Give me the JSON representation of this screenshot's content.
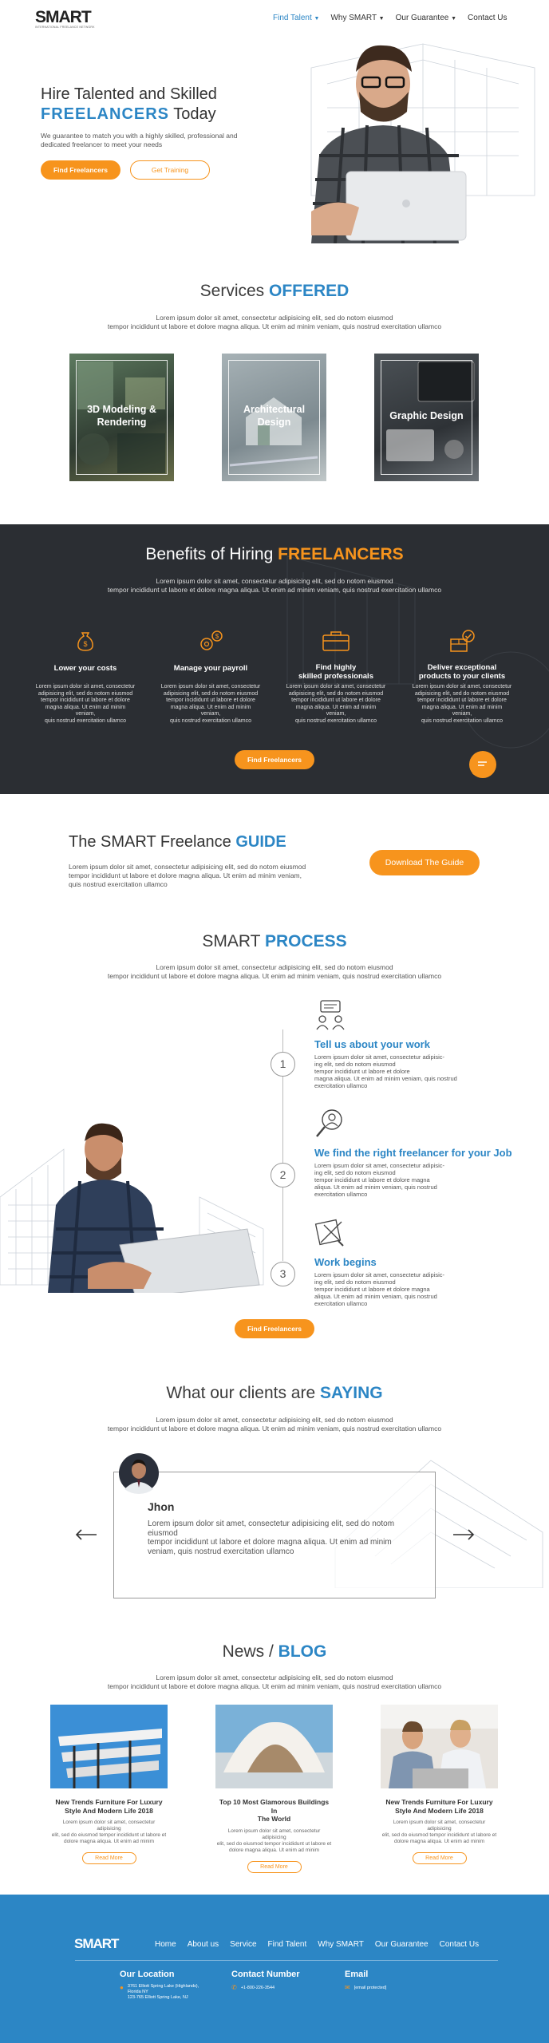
{
  "nav": {
    "logo": "SMART",
    "logo_tag": "INTERNATIONAL FREELANCE NETWORK",
    "items": [
      "Find Talent",
      "Why SMART",
      "Our Guarantee",
      "Contact Us"
    ]
  },
  "hero": {
    "line1": "Hire Talented and Skilled",
    "highlight": "FREELANCERS",
    "tail": "Today",
    "text": "We guarantee to match you with a highly skilled, professional and dedicated freelancer to meet your needs",
    "btn_primary": "Find Freelancers",
    "btn_secondary": "Get Training"
  },
  "services": {
    "title": "Services",
    "title_highlight": "OFFERED",
    "text1": "Lorem ipsum dolor sit amet, consectetur adipisicing elit, sed do notom eiusmod",
    "text2": "tempor incididunt ut labore et dolore magna aliqua. Ut enim ad minim veniam, quis nostrud exercitation ullamco",
    "cards": [
      {
        "line1": "3D Modeling &",
        "line2": "Rendering"
      },
      {
        "line1": "Architectural",
        "line2": "Design"
      },
      {
        "line1": "Graphic Design",
        "line2": ""
      }
    ]
  },
  "benefits": {
    "title": "Benefits of Hiring",
    "title_highlight": "FREELANCERS",
    "text1": "Lorem ipsum dolor sit amet, consectetur adipisicing elit, sed do notom eiusmod",
    "text2": "tempor incididunt ut labore et dolore magna aliqua. Ut enim ad minim veniam, quis nostrud exercitation ullamco",
    "items": [
      {
        "title1": "Lower your costs",
        "title2": "",
        "icon": "money-bag-icon"
      },
      {
        "title1": "Manage your payroll",
        "title2": "",
        "icon": "payroll-gear-icon"
      },
      {
        "title1": "Find highly",
        "title2": "skilled professionals",
        "icon": "briefcase-icon"
      },
      {
        "title1": "Deliver exceptional",
        "title2": "products to your clients",
        "icon": "box-check-icon"
      }
    ],
    "item_text": [
      "Lorem ipsum dolor sit amet, consectetur",
      "adipisicing elit, sed do notom eiusmod",
      "tempor incididunt ut labore et dolore",
      "magna aliqua. Ut enim ad minim veniam,",
      "quis nostrud exercitation ullamco"
    ],
    "button": "Find Freelancers"
  },
  "guide": {
    "title": "The SMART Freelance",
    "title_highlight": "GUIDE",
    "text": [
      "Lorem ipsum dolor sit amet, consectetur adipisicing elit, sed do notom eiusmod",
      "tempor incididunt ut labore et dolore magna aliqua. Ut enim ad minim veniam,",
      "quis nostrud exercitation ullamco"
    ],
    "button": "Download The Guide"
  },
  "process": {
    "title": "SMART",
    "title_highlight": "PROCESS",
    "text1": "Lorem ipsum dolor sit amet, consectetur adipisicing elit, sed do notom eiusmod",
    "text2": "tempor incididunt ut labore et dolore magna aliqua. Ut enim ad minim veniam, quis nostrud exercitation ullamco",
    "steps": [
      {
        "num": "1",
        "title": "Tell us about your work",
        "text": [
          "Lorem ipsum dolor sit amet, consectetur adipisic-",
          "ing elit, sed do notom eiusmod",
          "tempor incididunt ut labore et dolore",
          "magna aliqua. Ut enim ad minim veniam, quis nostrud",
          "exercitation ullamco"
        ]
      },
      {
        "num": "2",
        "title": "We find the right freelancer for your Job",
        "text": [
          "Lorem ipsum dolor sit amet, consectetur adipisic-",
          "ing elit, sed do notom eiusmod",
          "tempor incididunt ut labore et dolore magna",
          "aliqua. Ut enim ad minim veniam, quis nostrud",
          "exercitation ullamco"
        ]
      },
      {
        "num": "3",
        "title": "Work begins",
        "text": [
          "Lorem ipsum dolor sit amet, consectetur adipisic-",
          "ing elit, sed do notom eiusmod",
          "tempor incididunt ut labore et dolore magna",
          "aliqua. Ut enim ad minim veniam, quis nostrud",
          "exercitation ullamco"
        ]
      }
    ],
    "button": "Find Freelancers"
  },
  "testimonials": {
    "title": "What our clients are",
    "title_highlight": "SAYING",
    "text1": "Lorem ipsum dolor sit amet, consectetur adipisicing elit, sed do notom eiusmod",
    "text2": "tempor incididunt ut labore et dolore magna aliqua. Ut enim ad minim veniam, quis nostrud exercitation ullamco",
    "name": "Jhon",
    "quote": [
      "Lorem ipsum dolor sit amet, consectetur adipisicing elit, sed do notom",
      "eiusmod",
      "tempor incididunt ut labore et dolore magna aliqua. Ut enim ad minim",
      "veniam, quis nostrud exercitation ullamco"
    ]
  },
  "blog": {
    "title": "News /",
    "title_highlight": "BLOG",
    "text1": "Lorem ipsum dolor sit amet, consectetur adipisicing elit, sed do notom eiusmod",
    "text2": "tempor incididunt ut labore et dolore magna aliqua. Ut enim ad minim veniam, quis nostrud exercitation ullamco",
    "posts": [
      {
        "title1": "New Trends Furniture For Luxury",
        "title2": "Style And Modern Life 2018"
      },
      {
        "title1": "Top 10 Most Glamorous Buildings In",
        "title2": "The World"
      },
      {
        "title1": "New Trends Furniture For Luxury",
        "title2": "Style And Modern Life 2018"
      }
    ],
    "post_text": [
      "Lorem ipsum dolor sit amet, consectetur adipisicing",
      "elit, sed do eiusmod tempor incididunt ut labore et",
      "dolore magna aliqua. Ut enim ad minim"
    ],
    "read_more": "Read More"
  },
  "footer": {
    "logo": "SMART",
    "nav": [
      "Home",
      "About us",
      "Service",
      "Find Talent",
      "Why SMART",
      "Our Guarantee",
      "Contact Us"
    ],
    "location_title": "Our Location",
    "location_lines": [
      "3761 Elliott Spring Lake (Highlands),",
      "Florida NY",
      "123-765 Elliott Spring Lake, NJ"
    ],
    "contact_title": "Contact Number",
    "phone": "+1-800-226-3544",
    "email_title": "Email",
    "email": "[email protected]",
    "accent": "#2c86c5",
    "orange": "#f7941d"
  }
}
